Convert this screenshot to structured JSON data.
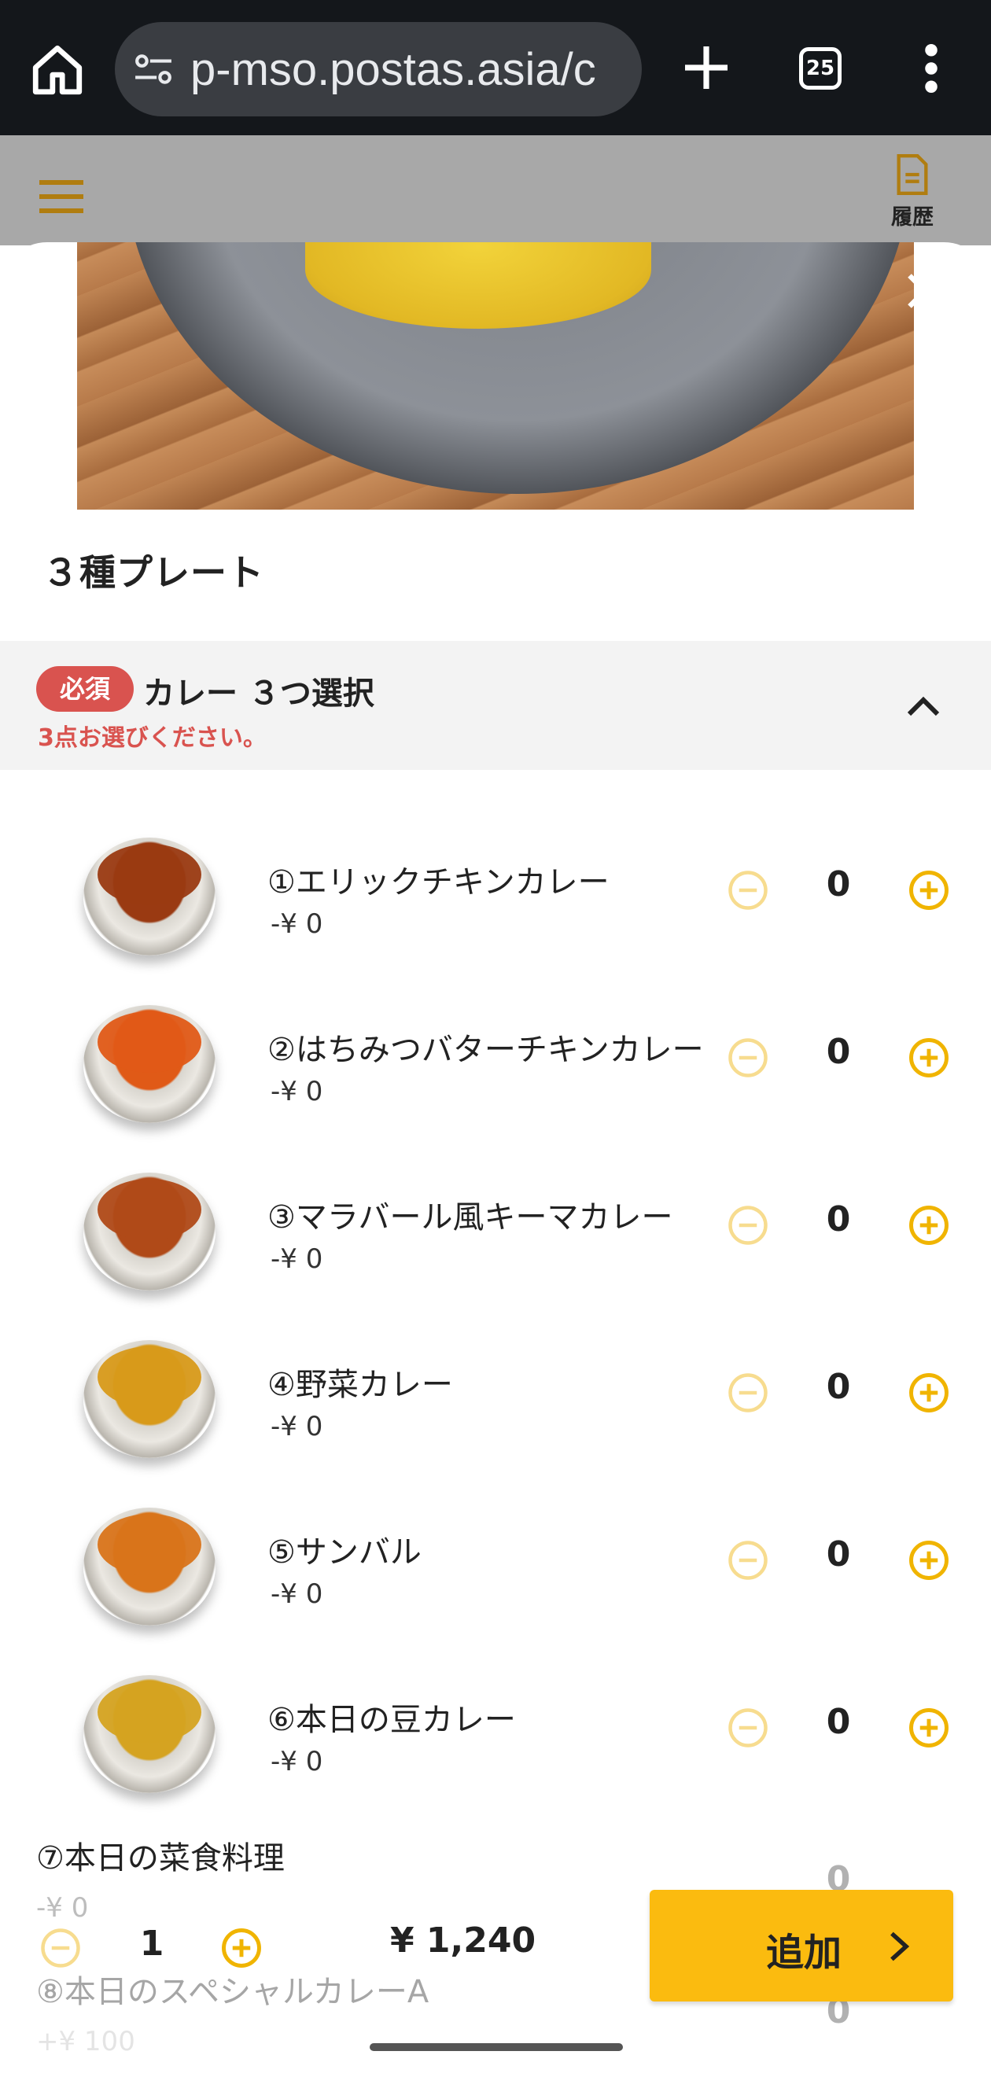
{
  "browser": {
    "url": "p-mso.postas.asia/c",
    "tab_count": "25"
  },
  "header": {
    "history_label": "履歴"
  },
  "item": {
    "title": "３種プレート"
  },
  "group": {
    "required_badge": "必須",
    "title": "カレー ３つ選択",
    "subtitle": "3点お選びください。"
  },
  "options": [
    {
      "name": "①エリックチキンカレー",
      "price": "-¥ 0",
      "qty": "0",
      "color": "#9a3a12"
    },
    {
      "name": "②はちみつバターチキンカレー",
      "price": "-¥ 0",
      "qty": "0",
      "color": "#e05a17"
    },
    {
      "name": "③マラバール風キーマカレー",
      "price": "-¥ 0",
      "qty": "0",
      "color": "#b04a18"
    },
    {
      "name": "④野菜カレー",
      "price": "-¥ 0",
      "qty": "0",
      "color": "#d89a1a"
    },
    {
      "name": "⑤サンバル",
      "price": "-¥ 0",
      "qty": "0",
      "color": "#d9741a"
    },
    {
      "name": "⑥本日の豆カレー",
      "price": "-¥ 0",
      "qty": "0",
      "color": "#d5a321"
    },
    {
      "name": "⑦本日の菜食料理",
      "price": "-¥ 0",
      "qty": "0"
    },
    {
      "name": "⑧本日のスペシャルカレーA",
      "price": "+¥ 100",
      "qty": "0"
    }
  ],
  "footer": {
    "quantity": "1",
    "total": "¥ 1,240",
    "add_label": "追加"
  },
  "colors": {
    "accent": "#fbbb0f",
    "icon_yellow": "#f0b400",
    "required_red": "#d9534f"
  }
}
